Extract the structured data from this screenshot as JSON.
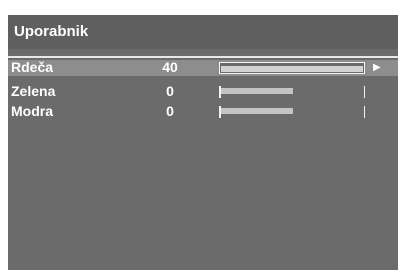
{
  "menu": {
    "title": "Uporabnik",
    "arrow_icon": "▶",
    "colors": {
      "panel_bg": "#6b6b6b",
      "header_bg": "#5f5f5f",
      "selected_row_bg": "#8d8d8d",
      "text": "#ffffff",
      "bar_fill": "#c4c4c4"
    },
    "settings": [
      {
        "label": "Rdeča",
        "value": "40",
        "level_percent": 100,
        "selected": true
      },
      {
        "label": "Zelena",
        "value": "0",
        "level_percent": 50,
        "selected": false
      },
      {
        "label": "Modra",
        "value": "0",
        "level_percent": 50,
        "selected": false
      }
    ]
  }
}
